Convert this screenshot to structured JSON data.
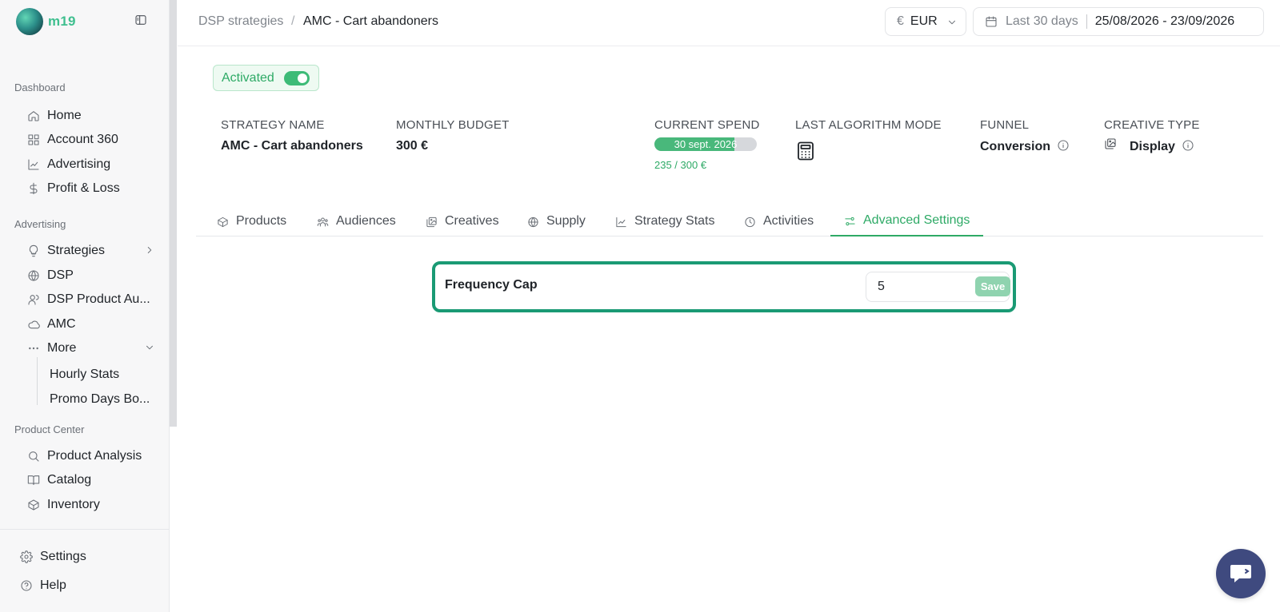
{
  "brand": {
    "name": "m19"
  },
  "sidebar": {
    "sections": [
      {
        "title": "Dashboard"
      },
      {
        "title": "Advertising"
      },
      {
        "title": "Product Center"
      }
    ],
    "dashboard_items": [
      {
        "label": "Home",
        "icon": "home-icon"
      },
      {
        "label": "Account 360",
        "icon": "grid-icon"
      },
      {
        "label": "Advertising",
        "icon": "chart-icon"
      },
      {
        "label": "Profit & Loss",
        "icon": "dollar-icon"
      }
    ],
    "advertising_items": [
      {
        "label": "Strategies",
        "icon": "lightbulb-icon"
      },
      {
        "label": "DSP",
        "icon": "globe-icon"
      },
      {
        "label": "DSP Product Au...",
        "icon": "users-icon"
      },
      {
        "label": "AMC",
        "icon": "cloud-icon"
      },
      {
        "label": "More",
        "icon": "ellipsis-icon"
      }
    ],
    "more_items": [
      {
        "label": "Hourly Stats"
      },
      {
        "label": "Promo Days Bo..."
      }
    ],
    "product_items": [
      {
        "label": "Product Analysis",
        "icon": "search-icon"
      },
      {
        "label": "Catalog",
        "icon": "book-icon"
      },
      {
        "label": "Inventory",
        "icon": "box-icon"
      }
    ],
    "bottom_items": [
      {
        "label": "Settings",
        "icon": "gear-icon"
      },
      {
        "label": "Help",
        "icon": "help-icon"
      }
    ]
  },
  "header": {
    "breadcrumb_parent": "DSP strategies",
    "breadcrumb_sep": "/",
    "breadcrumb_current": "AMC - Cart abandoners",
    "currency_symbol": "€",
    "currency": "EUR",
    "date_preset": "Last 30 days",
    "date_range": "25/08/2026 - 23/09/2026"
  },
  "strategy": {
    "status": "Activated",
    "fields": {
      "name_label": "STRATEGY NAME",
      "name_value": "AMC - Cart abandoners",
      "budget_label": "MONTHLY BUDGET",
      "budget_value": "300 €",
      "spend_label": "CURRENT SPEND",
      "spend_bar_label": "30 sept. 2026",
      "spend_progress": 0.78,
      "spend_value": "235 / 300 €",
      "algo_label": "LAST ALGORITHM MODE",
      "funnel_label": "FUNNEL",
      "funnel_value": "Conversion",
      "creative_label": "CREATIVE TYPE",
      "creative_value": "Display"
    }
  },
  "tabs": [
    {
      "label": "Products",
      "icon": "cube-icon"
    },
    {
      "label": "Audiences",
      "icon": "audience-icon"
    },
    {
      "label": "Creatives",
      "icon": "images-icon"
    },
    {
      "label": "Supply",
      "icon": "globe-icon"
    },
    {
      "label": "Strategy Stats",
      "icon": "chart-icon"
    },
    {
      "label": "Activities",
      "icon": "clock-icon"
    },
    {
      "label": "Advanced Settings",
      "icon": "sliders-icon",
      "active": true
    }
  ],
  "advanced": {
    "frequency_cap_label": "Frequency Cap",
    "frequency_cap_value": "5",
    "save_label": "Save"
  },
  "colors": {
    "accent": "#2eaa66",
    "highlight_border": "#1a9a74",
    "chat_button": "#3f4a7f"
  }
}
